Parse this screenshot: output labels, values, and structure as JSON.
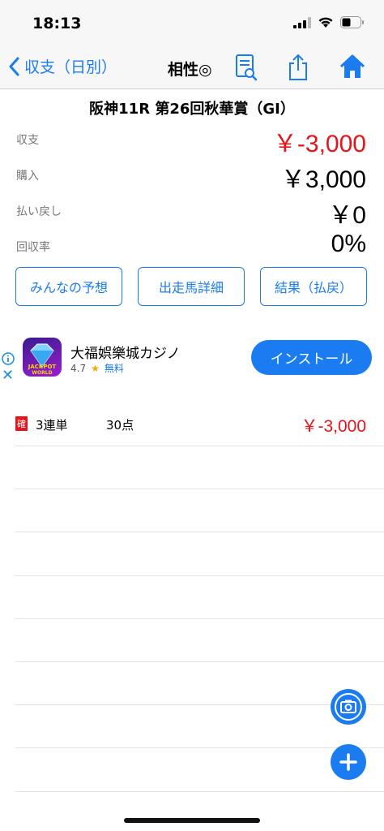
{
  "status": {
    "time": "18:13"
  },
  "nav": {
    "back_label": "収支（日別）",
    "title": "相性◎"
  },
  "race": {
    "title": "阪神11R 第26回秋華賞（GI）"
  },
  "summary": [
    {
      "label": "収支",
      "value": "￥-3,000",
      "negative": true
    },
    {
      "label": "購入",
      "value": "￥3,000",
      "negative": false
    },
    {
      "label": "払い戻し",
      "value": "￥0",
      "negative": false
    },
    {
      "label": "回収率",
      "value": "0%",
      "negative": false
    }
  ],
  "buttons": {
    "predictions": "みんなの予想",
    "entries": "出走馬詳細",
    "results": "結果（払戻）"
  },
  "ad": {
    "app_name": "大福娯樂城カジノ",
    "rating": "4.7",
    "price": "無料",
    "install_label": "インストール",
    "icon_text_1": "JACKPOT",
    "icon_text_2": "WORLD"
  },
  "bets": [
    {
      "badge": "確",
      "type": "3連単",
      "points": "30点",
      "amount": "￥-3,000"
    }
  ],
  "colors": {
    "accent": "#1a7cf0",
    "negative": "#e8141a"
  }
}
